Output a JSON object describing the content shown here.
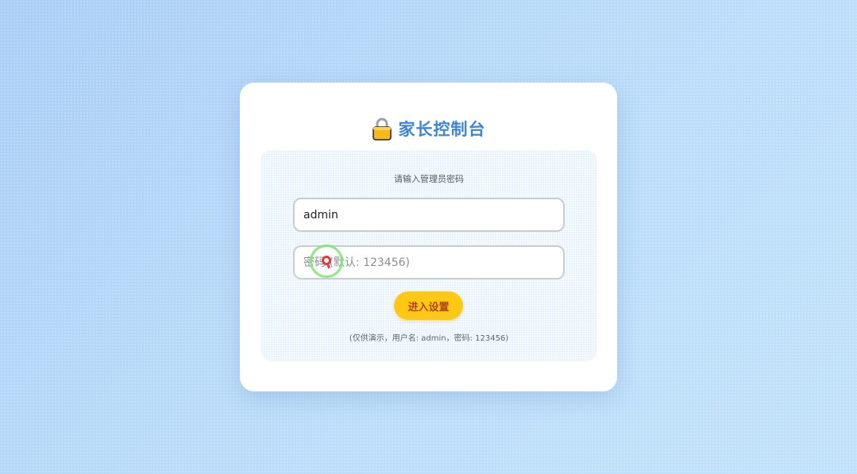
{
  "app": {
    "title": "家长控制台",
    "title_icon": "lock-icon"
  },
  "login": {
    "prompt": "请输入管理员密码",
    "username_value": "admin",
    "password_value": "",
    "password_placeholder": "密码 (默认: 123456)",
    "submit_label": "进入设置",
    "hint": "(仅供演示，用户名: admin，密码: 123456)"
  },
  "colors": {
    "accent_title": "#3d86d6",
    "button_bg": "#ffc815",
    "button_text": "#b0461a"
  }
}
